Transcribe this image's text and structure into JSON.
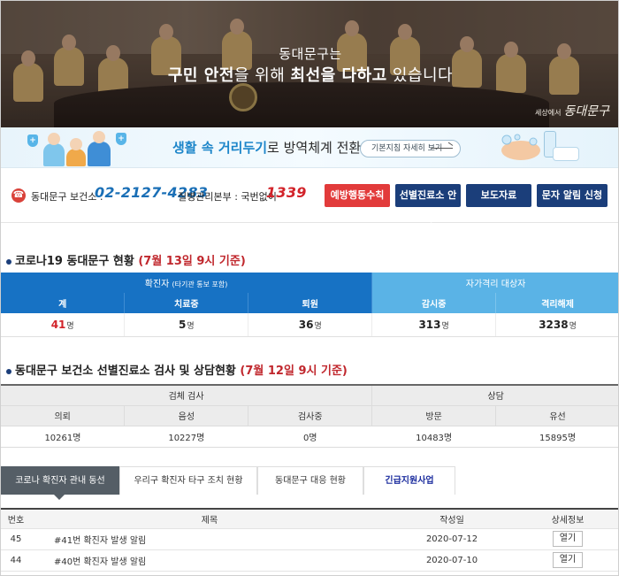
{
  "hero": {
    "subtitle": "동대문구는",
    "headline_bold1": "구민 안전",
    "headline_thin1": "을 위해 ",
    "headline_bold2": "최선을 다하고",
    "headline_thin2": " 있습니다",
    "logo_small": "세상에서",
    "logo": "동대문구"
  },
  "banner": {
    "text_highlight": "생활 속 거리두기",
    "text_rest": "로 방역체계 전환",
    "button_label": "기본지침 자세히 보기"
  },
  "contact": {
    "health_center_label": "동대문구 보건소 :",
    "health_center_phone": "02-2127-4283",
    "kcdc_label": "질병관리본부 : 국번없이",
    "kcdc_phone": "1339",
    "buttons": [
      "예방행동수칙",
      "선별진료소 안내",
      "보도자료",
      "문자 알림 신청"
    ]
  },
  "status": {
    "title": "코로나19 동대문구 현황",
    "title_date": "(7월 13일 9시 기준)",
    "confirmed_header": "확진자",
    "confirmed_note": "(타기관 통보 포함)",
    "quarantine_header": "자가격리 대상자",
    "columns": [
      "계",
      "치료중",
      "퇴원",
      "감시중",
      "격리해제"
    ],
    "values": [
      "41",
      "5",
      "36",
      "313",
      "3238"
    ],
    "unit": "명"
  },
  "screening": {
    "title": "동대문구 보건소 선별진료소 검사 및 상담현황",
    "title_date": "(7월 12일 9시 기준)",
    "test_header": "검체 검사",
    "consult_header": "상담",
    "columns": [
      "의뢰",
      "음성",
      "검사중",
      "방문",
      "유선"
    ],
    "values": [
      "10261명",
      "10227명",
      "0명",
      "10483명",
      "15895명"
    ]
  },
  "tabs": [
    "코로나 확진자 관내 동선",
    "우리구 확진자 타구 조치 현황",
    "동대문구 대응 현황",
    "긴급지원사업"
  ],
  "list": {
    "headers": [
      "번호",
      "제목",
      "작성일",
      "상세정보"
    ],
    "rows": [
      {
        "no": "45",
        "title": "#41번 확진자 발생 알림",
        "date": "2020-07-12",
        "action": "열기"
      },
      {
        "no": "44",
        "title": "#40번 확진자 발생 알림",
        "date": "2020-07-10",
        "action": "열기"
      }
    ]
  },
  "colors": {
    "primary_blue": "#1772c4",
    "light_blue": "#5ab3e6",
    "navy": "#1b3e7a",
    "accent_red": "#d2232a"
  }
}
